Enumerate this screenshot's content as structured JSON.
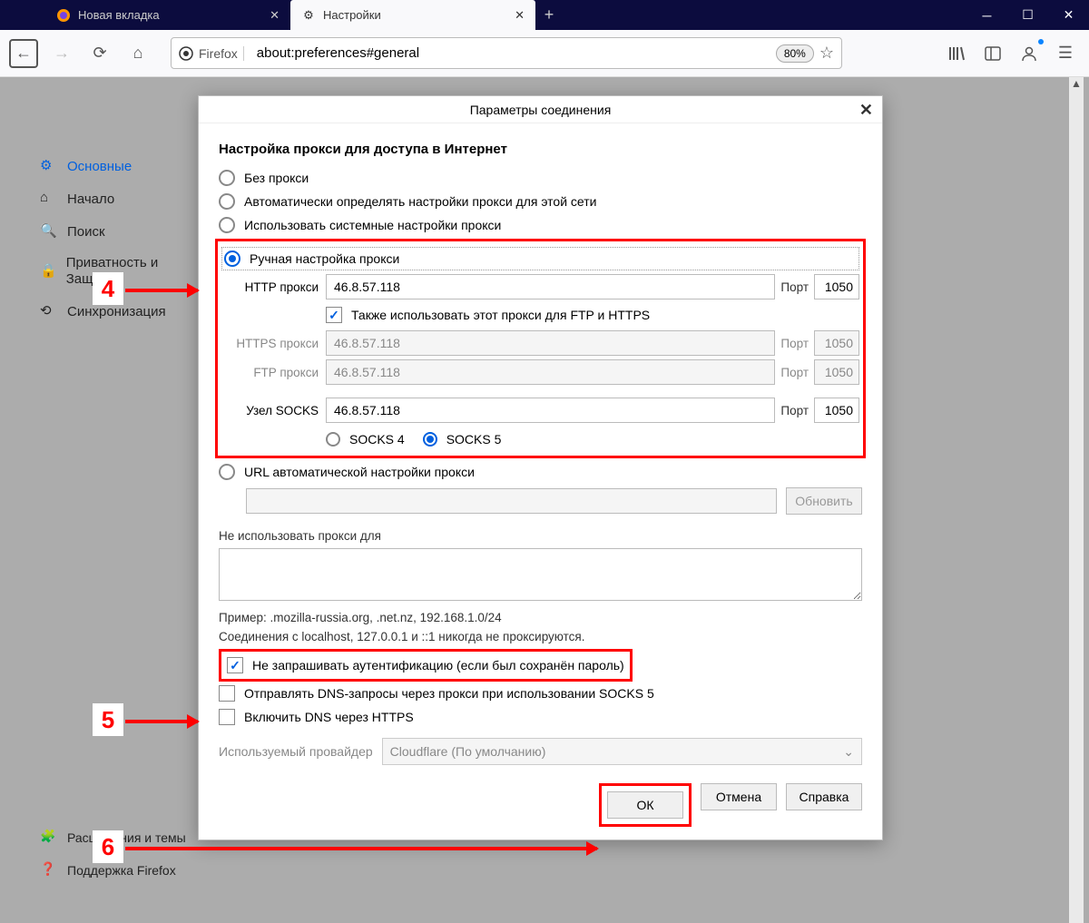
{
  "tabs": {
    "inactive": "Новая вкладка",
    "active": "Настройки"
  },
  "urlbar": {
    "identity": "Firefox",
    "url": "about:preferences#general",
    "zoom": "80%"
  },
  "sidebar": {
    "main": "Основные",
    "home": "Начало",
    "search": "Поиск",
    "privacy": "Приватность и Защита",
    "sync": "Синхронизация",
    "ext": "Расширения и темы",
    "support": "Поддержка Firefox"
  },
  "dialog": {
    "title": "Параметры соединения",
    "section": "Настройка прокси для доступа в Интернет",
    "opt_no": "Без прокси",
    "opt_auto": "Автоматически определять настройки прокси для этой сети",
    "opt_sys": "Использовать системные настройки прокси",
    "opt_manual": "Ручная настройка прокси",
    "http_label": "HTTP прокси",
    "http_value": "46.8.57.118",
    "http_port": "1050",
    "port_label": "Порт",
    "use_for_all": "Также использовать этот прокси для FTP и HTTPS",
    "https_label": "HTTPS прокси",
    "https_value": "46.8.57.118",
    "https_port": "1050",
    "ftp_label": "FTP прокси",
    "ftp_value": "46.8.57.118",
    "ftp_port": "1050",
    "socks_label": "Узел SOCKS",
    "socks_value": "46.8.57.118",
    "socks_port": "1050",
    "socks4": "SOCKS 4",
    "socks5": "SOCKS 5",
    "opt_pac": "URL автоматической настройки прокси",
    "reload": "Обновить",
    "no_proxy_for": "Не использовать прокси для",
    "example": "Пример: .mozilla-russia.org, .net.nz, 192.168.1.0/24",
    "localhost_note": "Соединения с localhost, 127.0.0.1 и ::1 никогда не проксируются.",
    "auth_check": "Не запрашивать аутентификацию (если был сохранён пароль)",
    "dns_socks": "Отправлять DNS-запросы через прокси при использовании SOCKS 5",
    "dns_https": "Включить DNS через HTTPS",
    "provider_label": "Используемый провайдер",
    "provider_value": "Cloudflare (По умолчанию)",
    "ok": "ОК",
    "cancel": "Отмена",
    "help": "Справка"
  },
  "annotations": {
    "n4": "4",
    "n5": "5",
    "n6": "6"
  }
}
